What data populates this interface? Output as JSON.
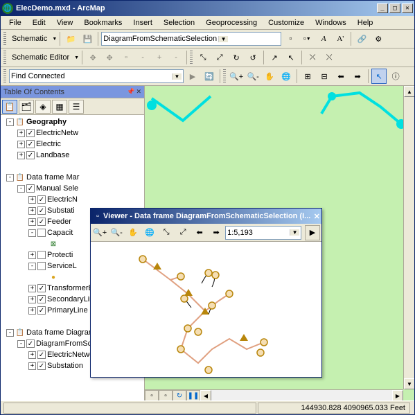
{
  "window": {
    "title": "ElecDemo.mxd - ArcMap"
  },
  "menu": [
    "File",
    "Edit",
    "View",
    "Bookmarks",
    "Insert",
    "Selection",
    "Geoprocessing",
    "Customize",
    "Windows",
    "Help"
  ],
  "toolbar1": {
    "schematic_label": "Schematic",
    "combo_value": "DiagramFromSchematicSelection"
  },
  "toolbar2": {
    "editor_label": "Schematic Editor"
  },
  "toolbar3": {
    "combo_value": "Find Connected"
  },
  "toc": {
    "title": "Table Of Contents",
    "items": [
      {
        "level": 0,
        "exp": "-",
        "chk": null,
        "icon": "📋",
        "label": "Geography",
        "bold": true
      },
      {
        "level": 1,
        "exp": "+",
        "chk": "✓",
        "icon": "",
        "label": "ElectricNetw"
      },
      {
        "level": 1,
        "exp": "+",
        "chk": "✓",
        "icon": "",
        "label": "Electric"
      },
      {
        "level": 1,
        "exp": "+",
        "chk": "✓",
        "icon": "",
        "label": "Landbase"
      },
      {
        "level": 0,
        "exp": null,
        "chk": null,
        "icon": "",
        "label": ""
      },
      {
        "level": 0,
        "exp": "-",
        "chk": null,
        "icon": "📋",
        "label": "Data frame Mar"
      },
      {
        "level": 1,
        "exp": "-",
        "chk": "✓",
        "icon": "",
        "label": "Manual Sele"
      },
      {
        "level": 2,
        "exp": "+",
        "chk": "✓",
        "icon": "",
        "label": "ElectricN"
      },
      {
        "level": 2,
        "exp": "+",
        "chk": "✓",
        "icon": "",
        "label": "Substati"
      },
      {
        "level": 2,
        "exp": "+",
        "chk": "✓",
        "icon": "",
        "label": "Feeder"
      },
      {
        "level": 2,
        "exp": "-",
        "chk": "",
        "icon": "",
        "label": "Capacit"
      },
      {
        "level": 3,
        "exp": null,
        "chk": null,
        "icon": "⊠",
        "label": ""
      },
      {
        "level": 2,
        "exp": "+",
        "chk": "",
        "icon": "",
        "label": "Protecti"
      },
      {
        "level": 2,
        "exp": "-",
        "chk": "",
        "icon": "",
        "label": "ServiceL"
      },
      {
        "level": 3,
        "exp": null,
        "chk": null,
        "icon": "●",
        "label": ""
      },
      {
        "level": 2,
        "exp": "+",
        "chk": "✓",
        "icon": "",
        "label": "TransformerBank"
      },
      {
        "level": 2,
        "exp": "+",
        "chk": "✓",
        "icon": "",
        "label": "SecondaryLine"
      },
      {
        "level": 2,
        "exp": "+",
        "chk": "✓",
        "icon": "",
        "label": "PrimaryLine"
      },
      {
        "level": 0,
        "exp": null,
        "chk": null,
        "icon": "",
        "label": ""
      },
      {
        "level": 0,
        "exp": "-",
        "chk": null,
        "icon": "📋",
        "label": "Data frame DiagramFromSc"
      },
      {
        "level": 1,
        "exp": "-",
        "chk": "✓",
        "icon": "",
        "label": "DiagramFromSchematic"
      },
      {
        "level": 2,
        "exp": "+",
        "chk": "✓",
        "icon": "",
        "label": "ElectricNetwork_Ne"
      },
      {
        "level": 2,
        "exp": "+",
        "chk": "✓",
        "icon": "",
        "label": "Substation"
      }
    ]
  },
  "viewer": {
    "title": "Viewer - Data frame DiagramFromSchematicSelection (I...",
    "scale": "1:5,193"
  },
  "status": {
    "coords": "144930.828  4090965.033 Feet"
  }
}
